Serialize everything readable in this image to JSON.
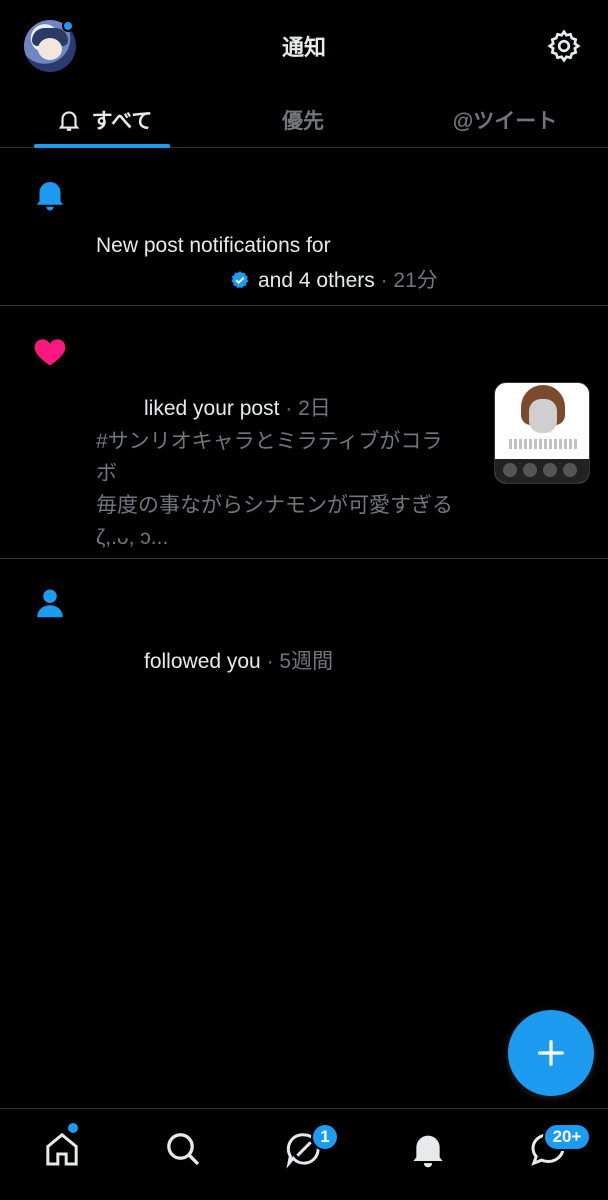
{
  "header": {
    "title": "通知",
    "avatar_icon": "user-avatar",
    "settings_icon": "gear-icon"
  },
  "tabs": [
    {
      "label": "すべて",
      "active": true,
      "icon": "bell-outline-icon"
    },
    {
      "label": "優先",
      "active": false
    },
    {
      "label": "@ツイート",
      "active": false
    }
  ],
  "notifications": [
    {
      "type": "new-post",
      "icon": "bell-icon",
      "line1": "New post notifications for",
      "line2": "and 4 others",
      "time": "· 21分"
    },
    {
      "type": "like",
      "icon": "heart-icon",
      "action": "liked your post",
      "time": "· 2日",
      "body": [
        "#サンリオキャラとミラティブがコラ",
        "ボ",
        "毎度の事ながらシナモンが可愛すぎる",
        "ζ,.ᴗ, ɔ..."
      ]
    },
    {
      "type": "follow",
      "icon": "person-icon",
      "action": "followed you",
      "time": "· 5週間"
    }
  ],
  "fab": {
    "icon": "plus-icon"
  },
  "bottom_nav": {
    "items": [
      "home-icon",
      "search-icon",
      "spaces-icon",
      "bell-icon",
      "message-icon"
    ],
    "spaces_badge": "1",
    "messages_badge": "20+"
  },
  "colors": {
    "accent": "#1d9bf0",
    "like": "#f91880",
    "muted": "#71767b",
    "text": "#e7e9ea",
    "background": "#000000"
  }
}
